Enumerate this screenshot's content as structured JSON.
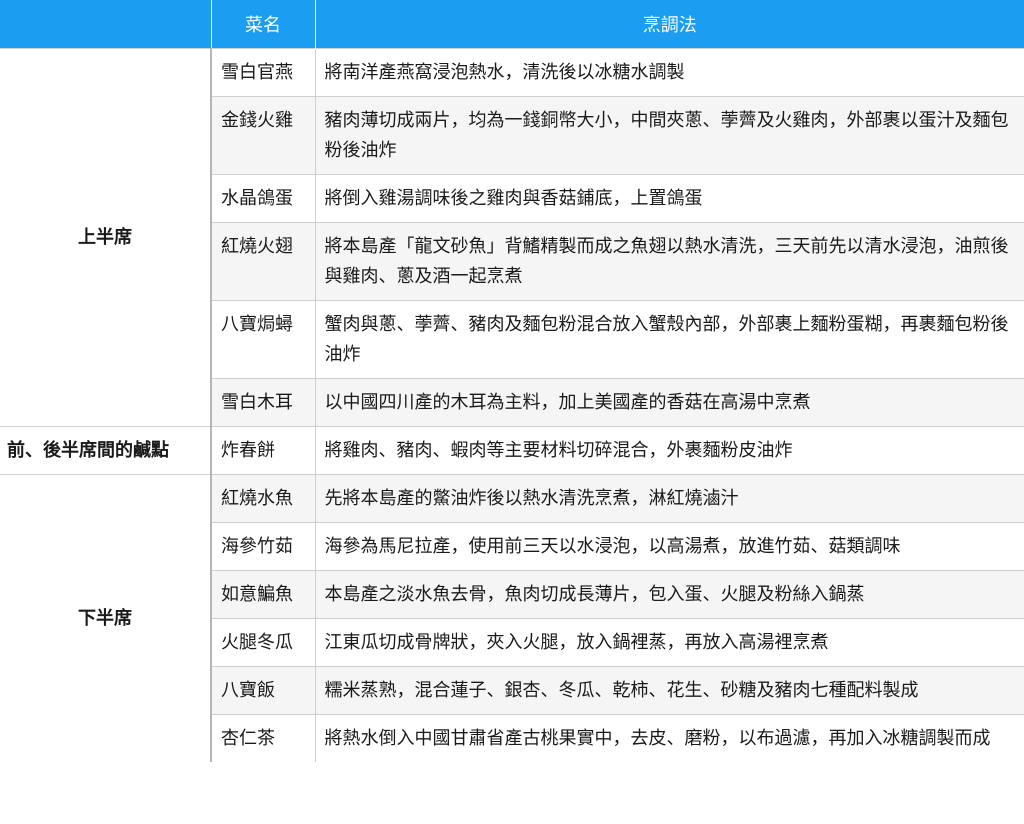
{
  "header": {
    "col0": "",
    "col1": "菜名",
    "col2": "烹調法"
  },
  "sections": {
    "first_half": "上半席",
    "snack": "前、後半席間的鹹點",
    "second_half": "下半席"
  },
  "rows": [
    {
      "dish": "雪白官燕",
      "method": "將南洋產燕窩浸泡熱水，清洗後以冰糖水調製"
    },
    {
      "dish": "金錢火雞",
      "method": "豬肉薄切成兩片，均為一錢銅幣大小，中間夾蔥、荸薺及火雞肉，外部裹以蛋汁及麵包粉後油炸"
    },
    {
      "dish": "水晶鴿蛋",
      "method": "將倒入雞湯調味後之雞肉與香菇鋪底，上置鴿蛋"
    },
    {
      "dish": "紅燒火翅",
      "method": "將本島產「龍文砂魚」背鰭精製而成之魚翅以熱水清洗，三天前先以清水浸泡，油煎後與雞肉、蔥及酒一起烹煮"
    },
    {
      "dish": "八寶焗蟳",
      "method": "蟹肉與蔥、荸薺、豬肉及麵包粉混合放入蟹殼內部，外部裹上麵粉蛋糊，再裹麵包粉後油炸"
    },
    {
      "dish": "雪白木耳",
      "method": "以中國四川產的木耳為主料，加上美國產的香菇在高湯中烹煮"
    },
    {
      "dish": "炸春餅",
      "method": "將雞肉、豬肉、蝦肉等主要材料切碎混合，外裹麵粉皮油炸"
    },
    {
      "dish": "紅燒水魚",
      "method": "先將本島產的鱉油炸後以熱水清洗烹煮，淋紅燒滷汁"
    },
    {
      "dish": "海參竹茹",
      "method": "海參為馬尼拉產，使用前三天以水浸泡，以高湯煮，放進竹茹、菇類調味"
    },
    {
      "dish": "如意鯿魚",
      "method": "本島產之淡水魚去骨，魚肉切成長薄片，包入蛋、火腿及粉絲入鍋蒸"
    },
    {
      "dish": "火腿冬瓜",
      "method": "江東瓜切成骨牌狀，夾入火腿，放入鍋裡蒸，再放入高湯裡烹煮"
    },
    {
      "dish": "八寶飯",
      "method": "糯米蒸熟，混合蓮子、銀杏、冬瓜、乾柿、花生、砂糖及豬肉七種配料製成"
    },
    {
      "dish": "杏仁茶",
      "method": "將熱水倒入中國甘肅省產古桃果實中，去皮、磨粉，以布過濾，再加入冰糖調製而成"
    }
  ]
}
